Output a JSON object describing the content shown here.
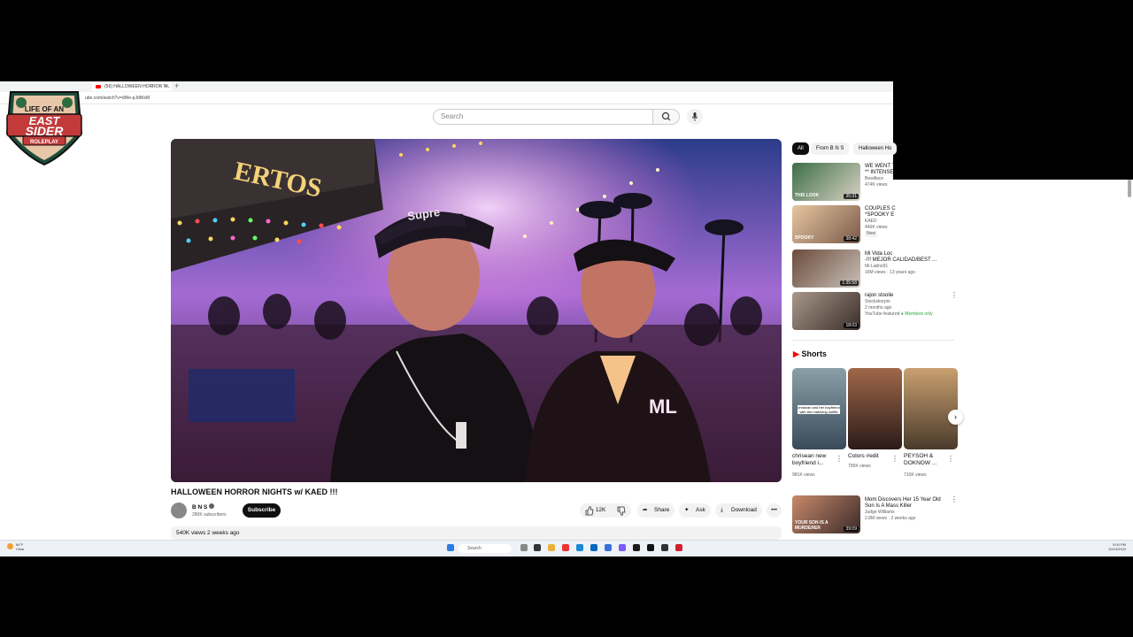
{
  "browser": {
    "tab_title": "(56) HALLOWEEN HORROR N...",
    "address": "ube.com/watch?v=dWe-pJdWsM"
  },
  "overlay": {
    "logo_lines": [
      "LIFE OF AN",
      "EAST",
      "SIDER",
      "ROLEPLAY"
    ]
  },
  "header": {
    "search_placeholder": "Search"
  },
  "video": {
    "title": "HALLOWEEN HORROR NIGHTS w/ KAED !!!",
    "channel": "B N S",
    "subscribers": "280K subscribers",
    "subscribe_label": "Subscribe",
    "likes": "12K",
    "share_label": "Share",
    "ask_label": "Ask",
    "download_label": "Download",
    "views_date": "540K views  2 weeks ago",
    "sign_left": "ERTOS",
    "hat_text": "Supre",
    "jacket_text": "ML"
  },
  "chips": [
    "All",
    "From B N S",
    "Halloween Ho"
  ],
  "recommendations": [
    {
      "title1": "WE WENT T",
      "title2": "** INTENSE",
      "channel": "Bewillace",
      "views": "474K views",
      "duration": "35:31",
      "thumb_text": "THIS LOOK"
    },
    {
      "title1": "COUPLES C",
      "title2": "*SPOOKY E",
      "channel": "KAED",
      "views": "446K views",
      "badge": "New",
      "duration": "38:42",
      "thumb_text": "SPOOKY"
    },
    {
      "title1": "Mi Vida Loc",
      "title2": "-!!! MEJOR CALIDAD/BEST ...",
      "channel": "Mr.Latino91",
      "views": "16M views · 13 years ago",
      "duration": "1:35:58"
    },
    {
      "title1": "rajon stoolie",
      "channel": "Stockskorpio",
      "views": "2 months ago",
      "extra1": "YouTube featured",
      "extra2": "Members only",
      "duration": "18:03"
    }
  ],
  "shorts": {
    "heading": "Shorts",
    "items": [
      {
        "title": "chrisean new boyfriend i...",
        "views": "981K views",
        "overlay_text": "chrisean and her boyfriend with the matching outfits"
      },
      {
        "title": "Colors #edit",
        "views": "795K views"
      },
      {
        "title": "PEYSOH & DOKNOW ...",
        "views": "710K views"
      }
    ]
  },
  "rec5": {
    "title1": "Mom Discovers Her 15 Year Old",
    "title2": "Son Is A Mass Killer",
    "channel": "Judge Williams",
    "views": "2.8M views · 2 weeks ago",
    "duration": "39:09",
    "thumb_text": "YOUR SON IS A MURDERER"
  },
  "taskbar": {
    "search": "Search",
    "time": "9:00 PM",
    "date": "10/24/2024",
    "weather_temp": "64°F",
    "weather_desc": "Clear"
  }
}
